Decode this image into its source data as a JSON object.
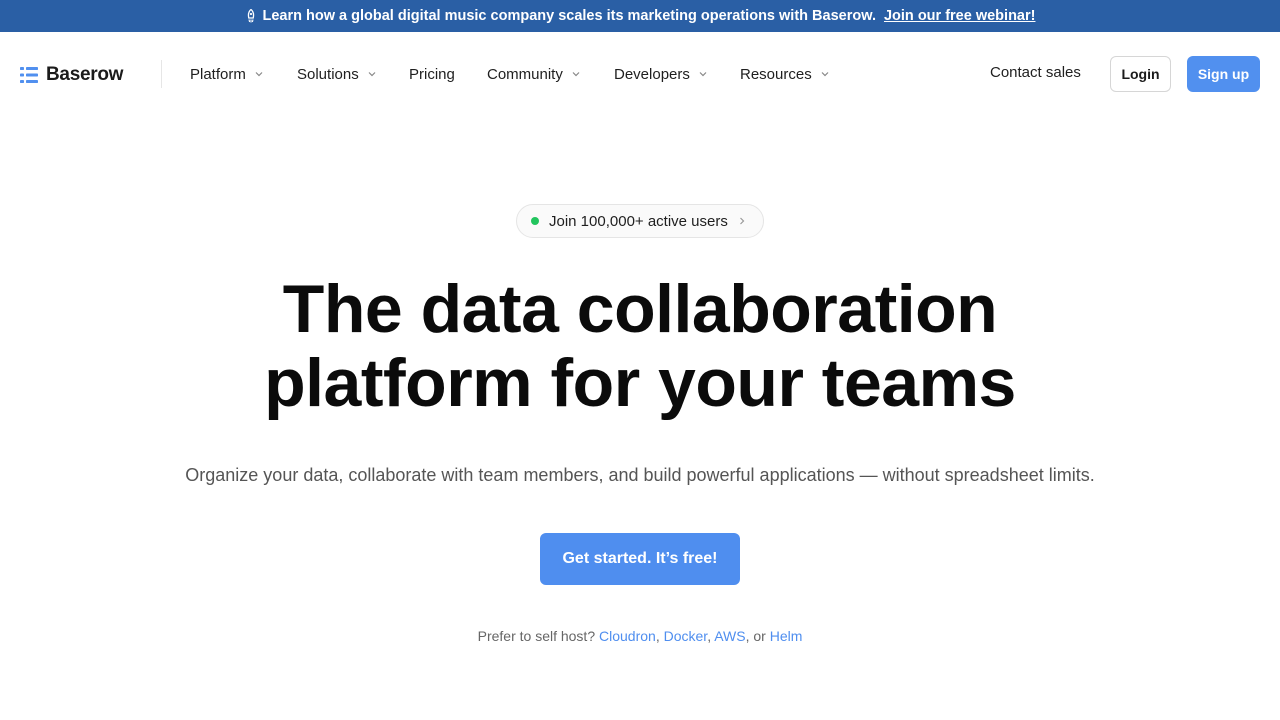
{
  "banner": {
    "text": "Learn how a global digital music company scales its marketing operations with Baserow.",
    "link": "Join our free webinar!",
    "icon": "rocket-icon",
    "background": "#2a5fa5"
  },
  "brand": {
    "name": "Baserow",
    "icon": "baserow-logo-icon",
    "color": "#5190ef"
  },
  "nav": {
    "items": [
      {
        "label": "Platform",
        "has_dropdown": true
      },
      {
        "label": "Solutions",
        "has_dropdown": true
      },
      {
        "label": "Pricing",
        "has_dropdown": false
      },
      {
        "label": "Community",
        "has_dropdown": true
      },
      {
        "label": "Developers",
        "has_dropdown": true
      },
      {
        "label": "Resources",
        "has_dropdown": true
      }
    ],
    "contact_label": "Contact sales",
    "login_label": "Login",
    "signup_label": "Sign up"
  },
  "hero": {
    "pill_text": "Join 100,000+ active users",
    "title_line1": "The data collaboration",
    "title_line2": "platform for your teams",
    "subtitle": "Organize your data, collaborate with team members, and build powerful applications — without spreadsheet limits.",
    "cta_label": "Get started. It’s free!"
  },
  "selfhost": {
    "prefix": "Prefer to self host?",
    "links": [
      "Cloudron",
      "Docker",
      "AWS",
      "Helm"
    ],
    "sep1": ", ",
    "sep2": ", ",
    "sep3": ", or "
  },
  "colors": {
    "accent": "#4f8eef",
    "status_dot": "#22c55e"
  }
}
